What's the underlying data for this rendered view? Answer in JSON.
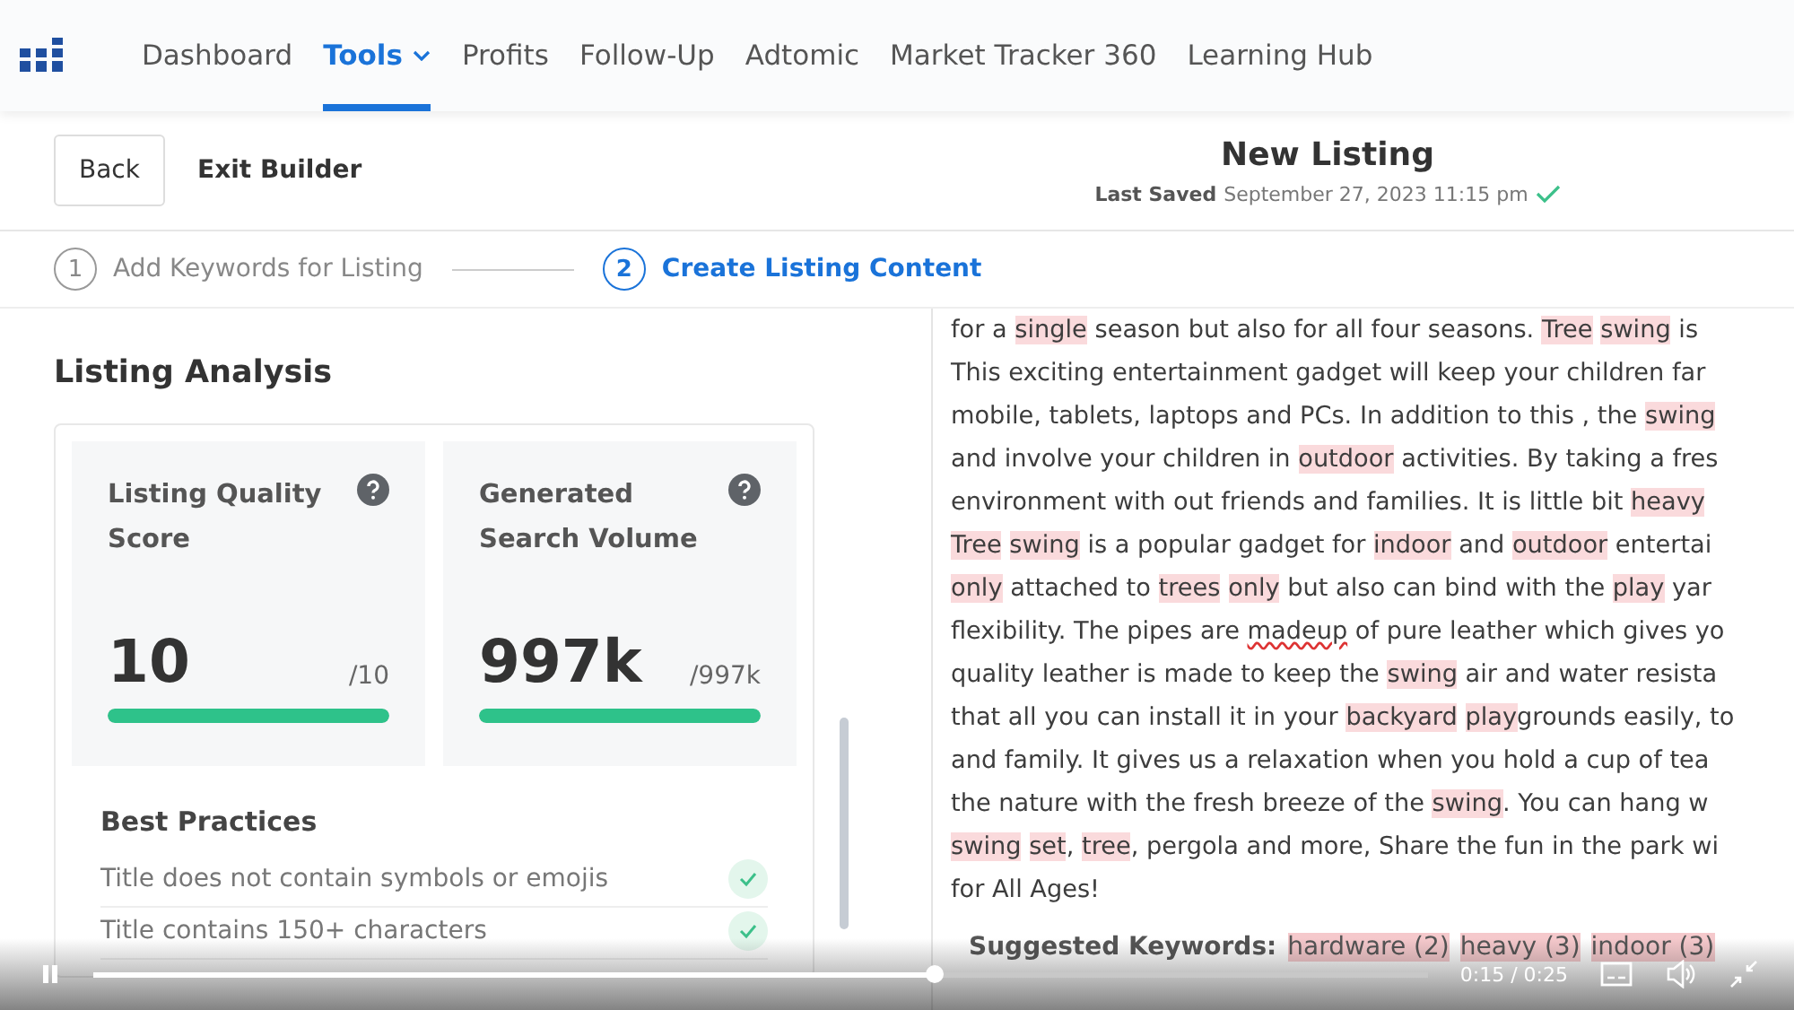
{
  "nav": {
    "items": [
      {
        "label": "Dashboard",
        "selected": false,
        "dropdown": false
      },
      {
        "label": "Tools",
        "selected": true,
        "dropdown": true
      },
      {
        "label": "Profits",
        "selected": false,
        "dropdown": false
      },
      {
        "label": "Follow-Up",
        "selected": false,
        "dropdown": false
      },
      {
        "label": "Adtomic",
        "selected": false,
        "dropdown": false
      },
      {
        "label": "Market Tracker 360",
        "selected": false,
        "dropdown": false
      },
      {
        "label": "Learning Hub",
        "selected": false,
        "dropdown": false
      }
    ]
  },
  "header": {
    "back": "Back",
    "exit": "Exit Builder",
    "title": "New Listing",
    "saved_label": "Last Saved",
    "saved_date": "September 27, 2023 11:15 pm",
    "saved": true
  },
  "steps": [
    {
      "number": "1",
      "label": "Add Keywords for Listing",
      "selected": false
    },
    {
      "number": "2",
      "label": "Create Listing Content",
      "selected": true
    }
  ],
  "analysis": {
    "title": "Listing Analysis",
    "metrics": [
      {
        "label": "Listing Quality Score",
        "value": "10",
        "max": "/10",
        "level": 1
      },
      {
        "label": "Generated Search Volume",
        "value": "997k",
        "max": "/997k",
        "level": 1
      }
    ],
    "best_practices": {
      "title": "Best Practices",
      "items": [
        {
          "text": "Title does not contain symbols or emojis",
          "passed": true
        },
        {
          "text": "Title contains 150+ characters",
          "passed": true
        }
      ]
    }
  },
  "content": {
    "lines": [
      [
        {
          "text": "for a ",
          "kind": "plain"
        },
        {
          "text": "single",
          "kind": "highlight"
        },
        {
          "text": " season but also for all four seasons. ",
          "kind": "plain"
        },
        {
          "text": "Tree",
          "kind": "highlight"
        },
        {
          "text": "swing",
          "kind": "highlight",
          "gap": true
        },
        {
          "text": " is",
          "kind": "plain"
        }
      ],
      [
        {
          "text": "This exciting entertainment gadget will keep your children far",
          "kind": "plain"
        }
      ],
      [
        {
          "text": "mobile, tablets, laptops and PCs. In addition to this , the ",
          "kind": "plain"
        },
        {
          "text": "swing",
          "kind": "highlight"
        }
      ],
      [
        {
          "text": "and involve your children in ",
          "kind": "plain"
        },
        {
          "text": "outdoor",
          "kind": "highlight"
        },
        {
          "text": " activities. By taking a fres",
          "kind": "plain"
        }
      ],
      [
        {
          "text": "environment with out friends and families. It is little bit ",
          "kind": "plain"
        },
        {
          "text": "heavy",
          "kind": "highlight"
        }
      ],
      [
        {
          "text": "Tree",
          "kind": "highlight"
        },
        {
          "text": "swing",
          "kind": "highlight",
          "gap": true
        },
        {
          "text": " is a popular gadget for ",
          "kind": "plain"
        },
        {
          "text": "indoor",
          "kind": "highlight"
        },
        {
          "text": " and ",
          "kind": "plain"
        },
        {
          "text": "outdoor",
          "kind": "highlight"
        },
        {
          "text": " entertai",
          "kind": "plain"
        }
      ],
      [
        {
          "text": "only",
          "kind": "highlight"
        },
        {
          "text": " attached to ",
          "kind": "plain"
        },
        {
          "text": "trees",
          "kind": "highlight"
        },
        {
          "text": "only",
          "kind": "highlight",
          "gap": true
        },
        {
          "text": " but also can bind with the ",
          "kind": "plain"
        },
        {
          "text": "play",
          "kind": "highlight"
        },
        {
          "text": " yar",
          "kind": "plain"
        }
      ],
      [
        {
          "text": "flexibility. The pipes are ",
          "kind": "plain"
        },
        {
          "text": "madeup",
          "kind": "misspelled"
        },
        {
          "text": " of pure leather which gives yo",
          "kind": "plain"
        }
      ],
      [
        {
          "text": "quality leather is made to keep the ",
          "kind": "plain"
        },
        {
          "text": "swing",
          "kind": "highlight"
        },
        {
          "text": " air and water resista",
          "kind": "plain"
        }
      ],
      [
        {
          "text": "that all you can install it in your ",
          "kind": "plain"
        },
        {
          "text": "backyard",
          "kind": "highlight"
        },
        {
          "text": "play",
          "kind": "highlight",
          "gap": true
        },
        {
          "text": "grounds easily, to",
          "kind": "plain"
        }
      ],
      [
        {
          "text": "and family. It gives us a relaxation when you hold a cup of tea",
          "kind": "plain"
        }
      ],
      [
        {
          "text": "the nature with the fresh breeze of the ",
          "kind": "plain"
        },
        {
          "text": "swing",
          "kind": "highlight"
        },
        {
          "text": ". You can hang w",
          "kind": "plain"
        }
      ],
      [
        {
          "text": "swing",
          "kind": "highlight"
        },
        {
          "text": "set",
          "kind": "highlight",
          "gap": true
        },
        {
          "text": ", ",
          "kind": "plain"
        },
        {
          "text": "tree",
          "kind": "highlight"
        },
        {
          "text": ", pergola and more, Share the fun in the park wi",
          "kind": "plain"
        }
      ],
      [
        {
          "text": "for All Ages!",
          "kind": "plain"
        }
      ]
    ],
    "suggested_label": "Suggested Keywords:",
    "suggested": [
      "hardware (2)",
      "heavy (3)",
      "indoor (3)"
    ]
  },
  "player": {
    "playing": true,
    "level": 0.63,
    "time": "0:15 / 0:25"
  }
}
